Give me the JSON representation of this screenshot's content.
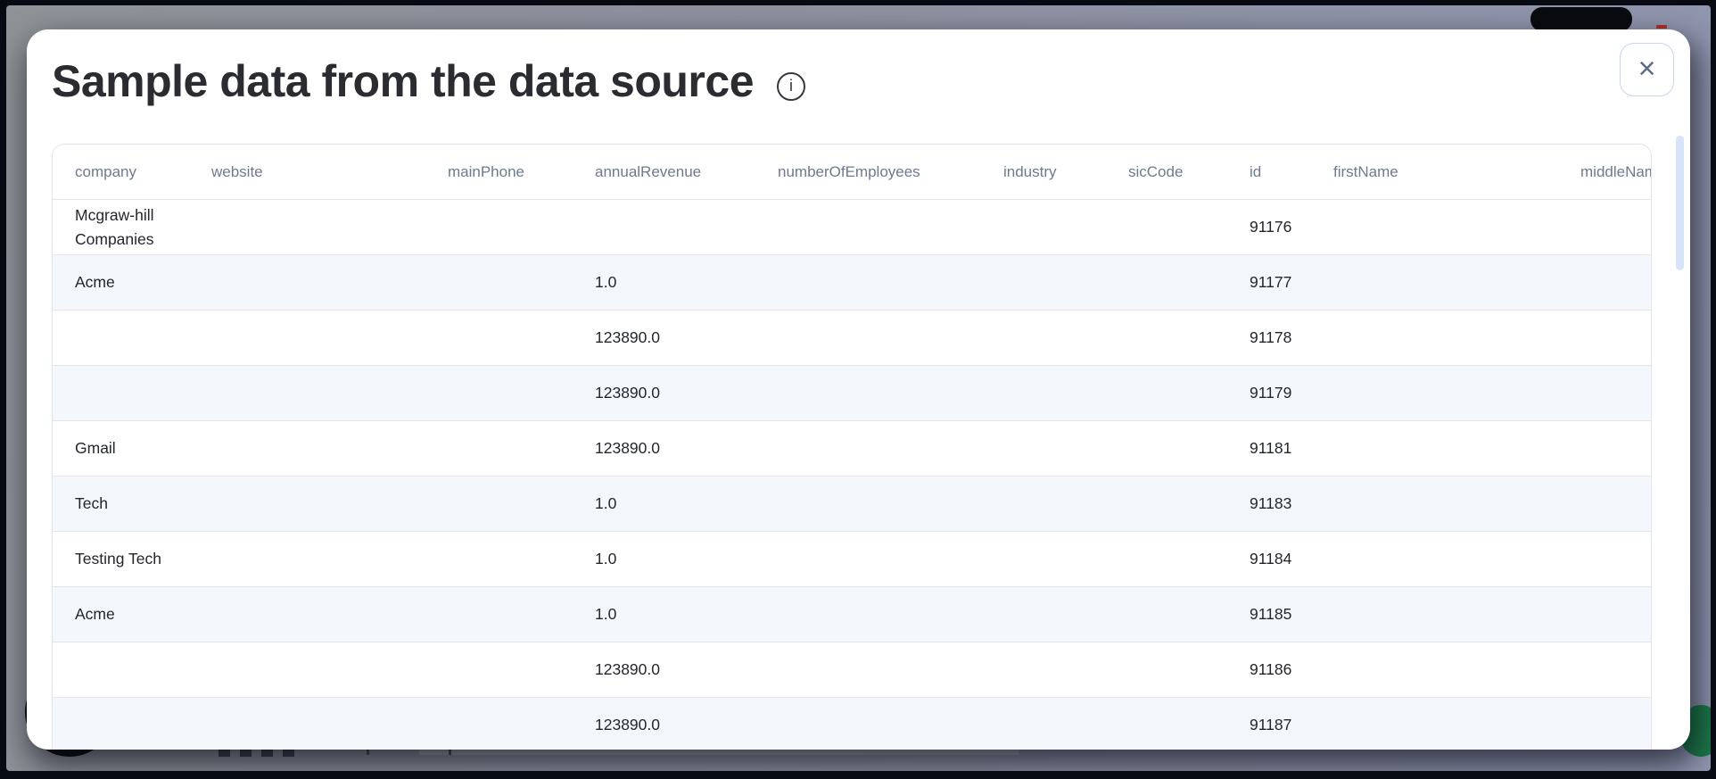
{
  "modal": {
    "title": "Sample data from the data source",
    "info_glyph": "i",
    "close_glyph": "×"
  },
  "table": {
    "columns": [
      "company",
      "website",
      "mainPhone",
      "annualRevenue",
      "numberOfEmployees",
      "industry",
      "sicCode",
      "id",
      "firstName",
      "middleName"
    ],
    "rows": [
      [
        "Mcgraw-hill Companies",
        "",
        "",
        "",
        "",
        "",
        "",
        "91176",
        "",
        ""
      ],
      [
        "Acme",
        "",
        "",
        "1.0",
        "",
        "",
        "",
        "91177",
        "",
        ""
      ],
      [
        "",
        "",
        "",
        "123890.0",
        "",
        "",
        "",
        "91178",
        "",
        ""
      ],
      [
        "",
        "",
        "",
        "123890.0",
        "",
        "",
        "",
        "91179",
        "",
        ""
      ],
      [
        "Gmail",
        "",
        "",
        "123890.0",
        "",
        "",
        "",
        "91181",
        "",
        ""
      ],
      [
        "Tech",
        "",
        "",
        "1.0",
        "",
        "",
        "",
        "91183",
        "",
        ""
      ],
      [
        "Testing Tech",
        "",
        "",
        "1.0",
        "",
        "",
        "",
        "91184",
        "",
        ""
      ],
      [
        "Acme",
        "",
        "",
        "1.0",
        "",
        "",
        "",
        "91185",
        "",
        ""
      ],
      [
        "",
        "",
        "",
        "123890.0",
        "",
        "",
        "",
        "91186",
        "",
        ""
      ],
      [
        "",
        "",
        "",
        "123890.0",
        "",
        "",
        "",
        "91187",
        "",
        ""
      ]
    ]
  },
  "colors": {
    "row_stripe": "#f4f7fc",
    "header_text": "#6e7a8e",
    "cell_text": "#23262e",
    "table_border": "#dce4f0",
    "scroll_thumb": "#d7e3f6",
    "backdrop_left": "#8f9297",
    "backdrop_right": "#9196b1",
    "green_widget": "#1d7a49",
    "orange_logo": "#b1521c"
  }
}
